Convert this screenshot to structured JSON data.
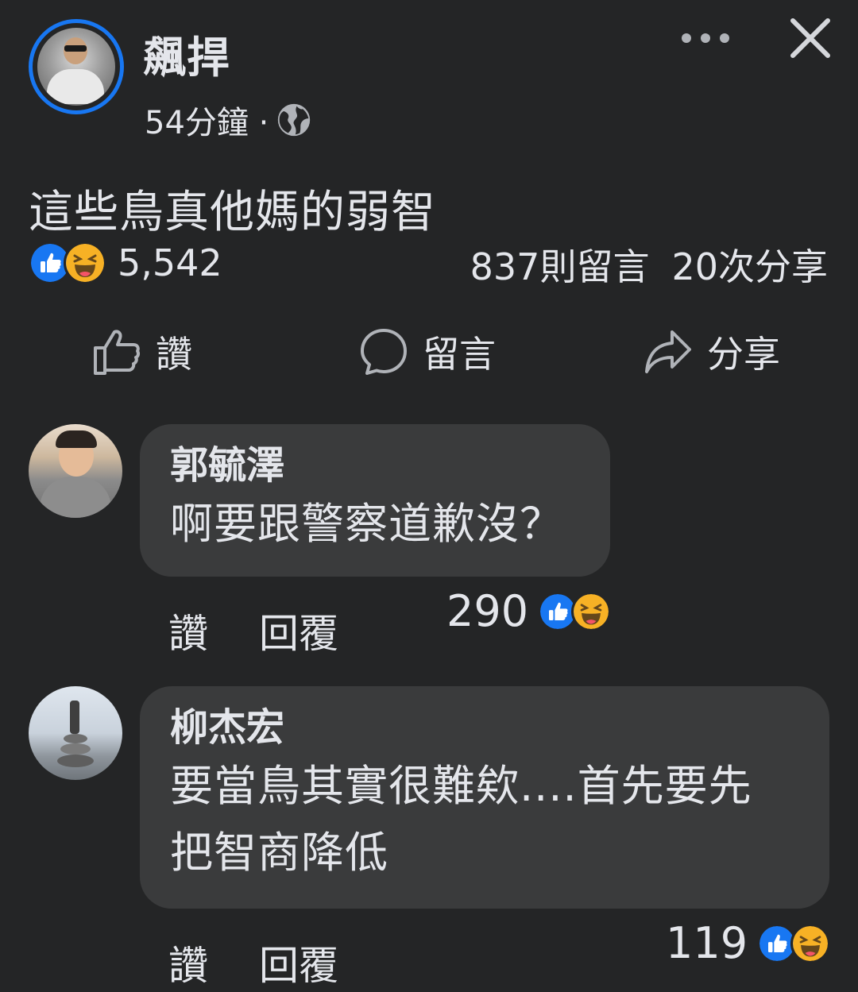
{
  "post": {
    "author": "飆捍",
    "time": "54分鐘 ·",
    "text": "這些鳥真他媽的弱智",
    "reaction_count": "5,542",
    "comments_count": "837則留言",
    "shares_count": "20次分享"
  },
  "actions": {
    "like": "讚",
    "comment": "留言",
    "share": "分享"
  },
  "comments": [
    {
      "name": "郭毓澤",
      "text": "啊要跟警察道歉沒？",
      "like": "讚",
      "reply": "回覆",
      "reactions": "290"
    },
    {
      "name": "柳杰宏",
      "line1": "要當鳥其實很難欸....首先要先",
      "line2": "把智商降低",
      "like": "讚",
      "reply": "回覆",
      "reactions": "119"
    }
  ],
  "colors": {
    "background": "#242526",
    "bubble": "#3a3b3c",
    "accent": "#1877f2",
    "text": "#e4e6eb",
    "haha": "#f7b125"
  },
  "icons": [
    "globe-icon",
    "more-icon",
    "close-icon",
    "like-icon",
    "comment-icon",
    "share-icon",
    "like-reaction-icon",
    "haha-reaction-icon"
  ]
}
